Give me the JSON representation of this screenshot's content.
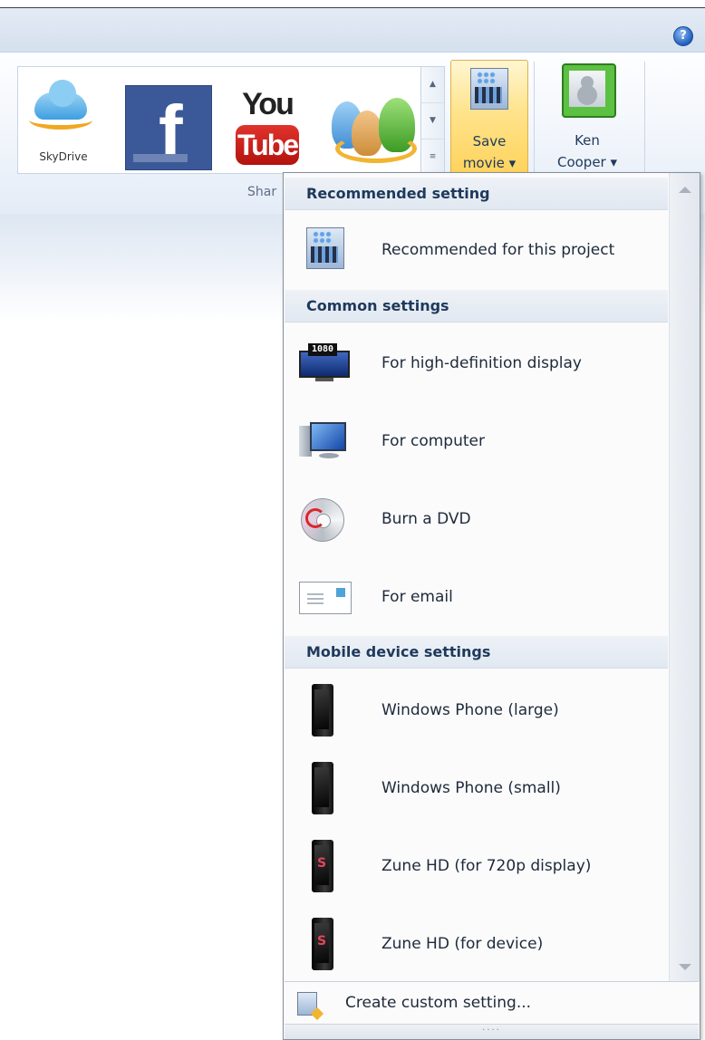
{
  "ribbon": {
    "help_glyph": "?",
    "gallery": {
      "items": [
        {
          "name": "skydrive",
          "label": "SkyDrive"
        },
        {
          "name": "facebook",
          "glyph": "f"
        },
        {
          "name": "youtube",
          "you": "You",
          "tube": "Tube"
        },
        {
          "name": "windows-live-groups"
        }
      ],
      "scroll_up": "▲",
      "scroll_down": "▼",
      "more": "≡"
    },
    "save_movie": {
      "line1": "Save",
      "line2": "movie ▾"
    },
    "account": {
      "line1": "Ken",
      "line2": "Cooper ▾"
    },
    "group_label": "Shar"
  },
  "menu": {
    "sections": {
      "recommended": "Recommended setting",
      "common": "Common settings",
      "mobile": "Mobile device settings"
    },
    "items": {
      "recommended": "Recommended for this project",
      "hd_display": "For high-definition display",
      "computer": "For computer",
      "dvd": "Burn a DVD",
      "email": "For email",
      "wp_large": "Windows Phone (large)",
      "wp_small": "Windows Phone (small)",
      "zune_720p": "Zune HD (for 720p display)",
      "zune_device": "Zune HD (for device)"
    },
    "tv_badge": "1080",
    "custom": "Create custom setting...",
    "grip": "····"
  },
  "colors": {
    "accent_text": "#1e395b",
    "save_highlight": "#ffd35c",
    "facebook": "#3b5998",
    "youtube_red": "#c4211b"
  }
}
